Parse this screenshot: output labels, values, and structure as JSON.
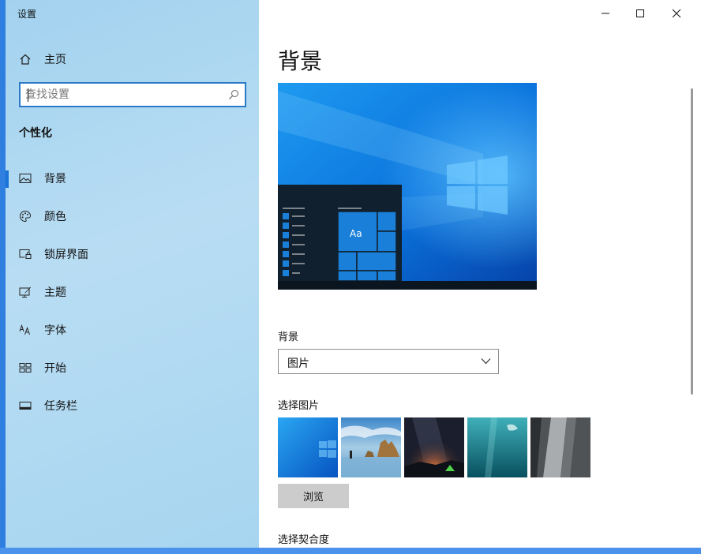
{
  "window": {
    "title": "设置",
    "controls": [
      "minimize-icon",
      "maximize-icon",
      "close-icon"
    ]
  },
  "sidebar": {
    "home_label": "主页",
    "search_placeholder": "查找设置",
    "section_title": "个性化",
    "items": [
      {
        "label": "背景",
        "icon": "picture-icon",
        "selected": true
      },
      {
        "label": "颜色",
        "icon": "palette-icon",
        "selected": false
      },
      {
        "label": "锁屏界面",
        "icon": "lock-screen-icon",
        "selected": false
      },
      {
        "label": "主题",
        "icon": "theme-icon",
        "selected": false
      },
      {
        "label": "字体",
        "icon": "font-icon",
        "selected": false
      },
      {
        "label": "开始",
        "icon": "start-icon",
        "selected": false
      },
      {
        "label": "任务栏",
        "icon": "taskbar-icon",
        "selected": false
      }
    ]
  },
  "main": {
    "page_title": "背景",
    "preview_tile_text": "Aa",
    "background_label": "背景",
    "background_value": "图片",
    "choose_picture_label": "选择图片",
    "browse_label": "浏览",
    "choose_fit_label": "选择契合度"
  },
  "colors": {
    "accent": "#0078d7",
    "sidebar_bg": "#a9d6f1",
    "selection_bar": "#1a73d8"
  }
}
